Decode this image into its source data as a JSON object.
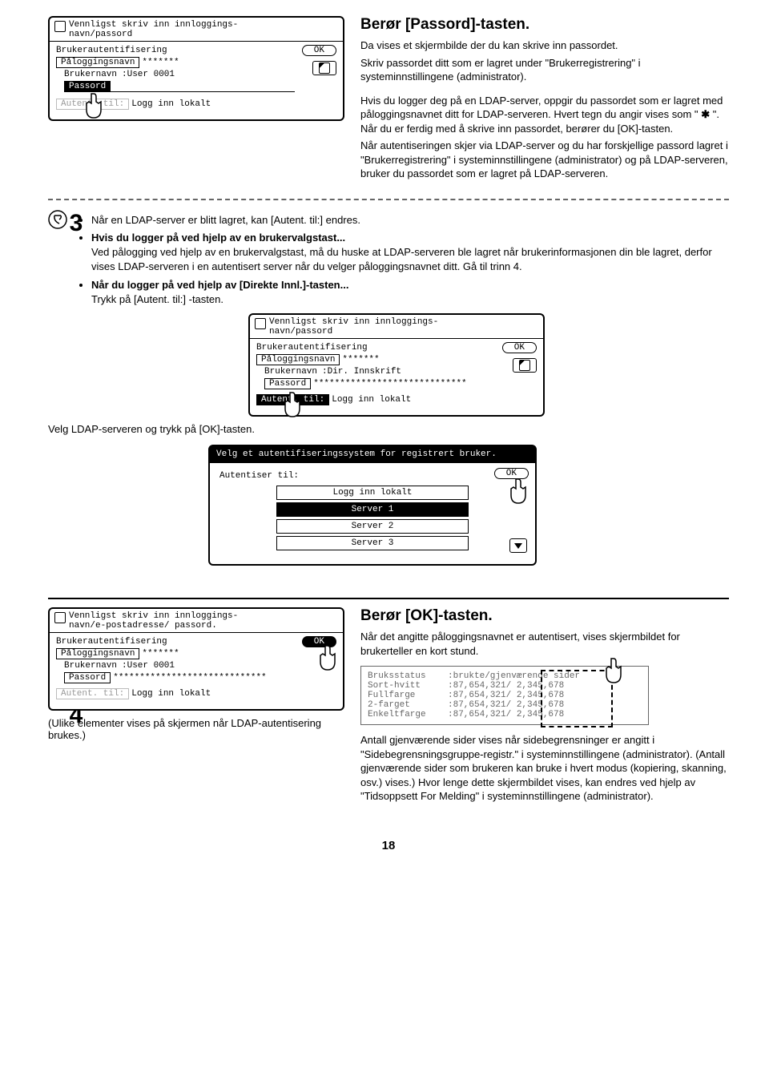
{
  "step3": {
    "panel1": {
      "header": "Vennligst skriv inn innloggings-\nnavn/passord",
      "auth_label": "Brukerautentifisering",
      "ok": "OK",
      "login_btn": "Påloggingsnavn",
      "login_val": "*******",
      "user_label": "Brukernavn",
      "user_val": ":User 0001",
      "pass_btn": "Passord",
      "authto_label": "Autent. til:",
      "authto_val": "Logg inn lokalt"
    },
    "title": "Berør [Passord]-tasten.",
    "p1": "Da vises et skjermbilde der du kan skrive inn passordet.",
    "p2": "Skriv passordet ditt som er lagret under \"Brukerregistrering\" i systeminnstillingene (administrator).",
    "p3a": "Hvis du logger deg på en LDAP-server, oppgir du passordet som er lagret med påloggingsnavnet ditt for LDAP-serveren. Hvert tegn du angir vises som \"",
    "p3b": "\". Når du er ferdig med å skrive inn passordet, berører du [OK]-tasten.",
    "p4": "Når autentiseringen skjer via LDAP-server og du har forskjellige passord lagret i \"Brukerregistrering\" i systeminnstillingene (administrator) og på LDAP-serveren, bruker du passordet som er lagret på LDAP-serveren."
  },
  "note": {
    "b1": "Når en LDAP-server er blitt lagret, kan [Autent. til:] endres.",
    "b2_title": "Hvis du logger på ved hjelp av en brukervalgstast...",
    "b2_body": "Ved pålogging ved hjelp av en brukervalgstast, må du huske at LDAP-serveren ble lagret når brukerinformasjonen din ble lagret, derfor vises LDAP-serveren i en autentisert server når du velger påloggingsnavnet ditt. Gå til trinn 4.",
    "b3_title": "Når du logger på ved hjelp av [Direkte Innl.]-tasten...",
    "b3_body": "Trykk på [Autent. til:] -tasten.",
    "panel2": {
      "header": "Vennligst skriv inn innloggings-\nnavn/passord",
      "auth_label": "Brukerautentifisering",
      "ok": "OK",
      "login_btn": "Påloggingsnavn",
      "login_val": "*******",
      "user_label": "Brukernavn",
      "user_val": ":Dir. Innskrift",
      "pass_btn": "Passord",
      "pass_val": "*****************************",
      "authto_label": "Autent. til:",
      "authto_val": "Logg inn lokalt"
    },
    "caption2": "Velg LDAP-serveren og trykk på [OK]-tasten.",
    "panel3": {
      "header": "Velg et autentifiseringssystem for registrert bruker.",
      "label": "Autentiser til:",
      "ok": "OK",
      "opt1": "Logg inn lokalt",
      "opt2": "Server 1",
      "opt3": "Server 2",
      "opt4": "Server 3"
    }
  },
  "step4": {
    "panel": {
      "header": "Vennligst skriv inn innloggings-\nnavn/e-postadresse/ passord.",
      "auth_label": "Brukerautentifisering",
      "ok": "OK",
      "login_btn": "Påloggingsnavn",
      "login_val": "*******",
      "user_label": "Brukernavn",
      "user_val": ":User 0001",
      "pass_btn": "Passord",
      "pass_val": "*****************************",
      "authto_label": "Autent. til:",
      "authto_val": "Logg inn lokalt"
    },
    "caption": "(Ulike elementer vises på skjermen når LDAP-autentisering brukes.)",
    "title": "Berør [OK]-tasten.",
    "p1": "Når det angitte påloggingsnavnet er autentisert, vises skjermbildet for brukerteller en kort stund.",
    "status": {
      "r1k": "Bruksstatus",
      "r1v": ":brukte/gjenværende sider",
      "r2k": "Sort-hvitt",
      "r2v": ":87,654,321/ 2,345,678",
      "r3k": "Fullfarge",
      "r3v": ":87,654,321/ 2,345,678",
      "r4k": "2-farget",
      "r4v": ":87,654,321/ 2,345,678",
      "r5k": "Enkeltfarge",
      "r5v": ":87,654,321/ 2,345,678"
    },
    "p2": "Antall gjenværende sider vises når sidebegrensninger er angitt i \"Sidebegrensningsgruppe-registr.\" i systeminnstillingene (administrator). (Antall gjenværende sider som brukeren kan bruke i hvert modus (kopiering, skanning, osv.) vises.) Hvor lenge dette skjermbildet vises, kan endres ved hjelp av \"Tidsoppsett For Melding\" i systeminnstillingene (administrator)."
  },
  "pagenum": "18"
}
